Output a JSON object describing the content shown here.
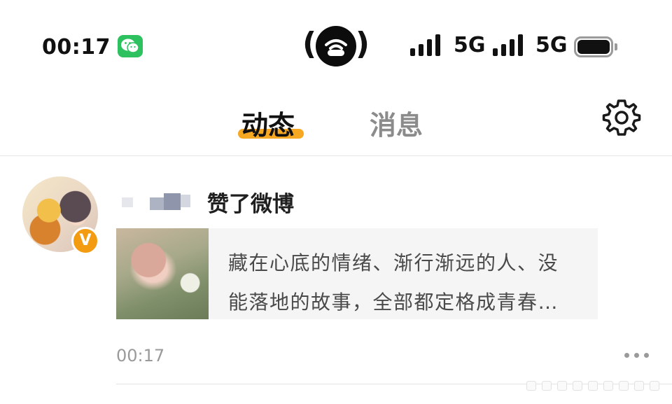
{
  "status_bar": {
    "time": "00:17",
    "app_icon": "wechat-icon",
    "center_indicator": "hotspot-icon",
    "network_1": "5G",
    "network_2": "5G",
    "battery_level": 1.0
  },
  "header": {
    "tabs": [
      {
        "label": "动态",
        "active": true
      },
      {
        "label": "消息",
        "active": false
      }
    ],
    "settings_icon": "gear-icon",
    "accent_color": "#f7a823"
  },
  "feed": {
    "items": [
      {
        "verified_badge": "V",
        "action": "赞了微博",
        "card_text_line1": "藏在心底的情绪、渐行渐远的人、没",
        "card_text_line2": "能落地的故事，全部都定格成青春…",
        "time": "00:17",
        "more_icon": "more-dots-icon"
      }
    ]
  }
}
